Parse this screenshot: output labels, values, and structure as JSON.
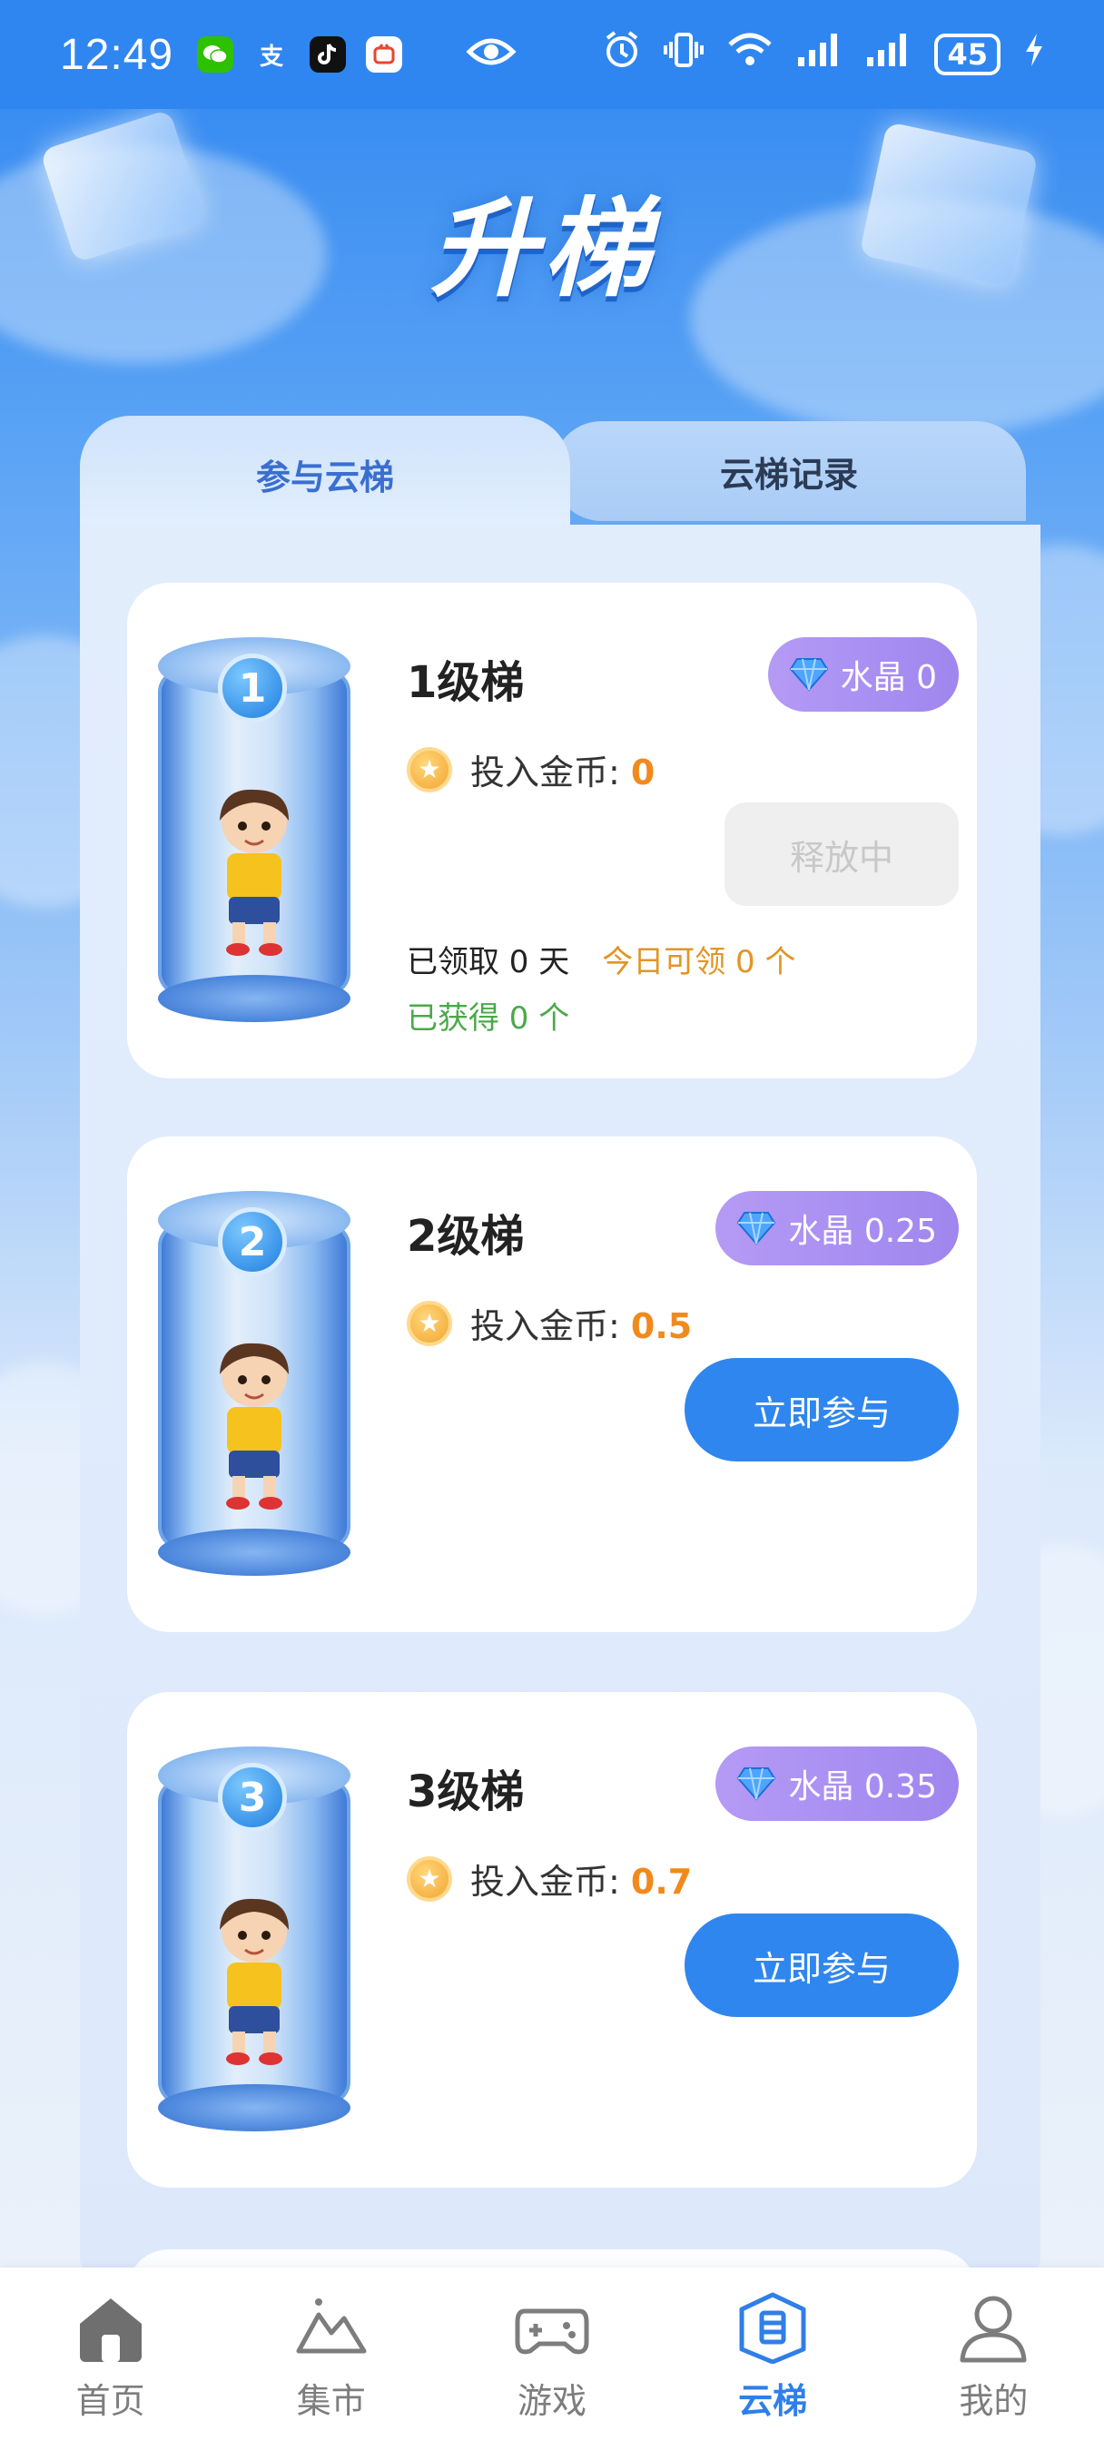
{
  "status_bar": {
    "time": "12:49",
    "apps": [
      "wechat-icon",
      "alipay-icon",
      "tiktok-icon",
      "app-icon"
    ],
    "alipay_glyph": "支",
    "battery": "45"
  },
  "page": {
    "title": "升梯"
  },
  "tabs": [
    {
      "label": "参与云梯",
      "active": true
    },
    {
      "label": "云梯记录",
      "active": false
    }
  ],
  "cards": [
    {
      "level_num": "1",
      "title": "1级梯",
      "crystal_label": "水晶 0",
      "coin_label": "投入金币: ",
      "coin_value": "0",
      "button_label": "释放中",
      "claimed": "已领取 0 天",
      "today": "今日可领 0 个",
      "got": "已获得 0 个"
    },
    {
      "level_num": "2",
      "title": "2级梯",
      "crystal_label": "水晶 0.25",
      "coin_label": "投入金币: ",
      "coin_value": "0.5",
      "button_label": "立即参与"
    },
    {
      "level_num": "3",
      "title": "3级梯",
      "crystal_label": "水晶 0.35",
      "coin_label": "投入金币: ",
      "coin_value": "0.7",
      "button_label": "立即参与"
    }
  ],
  "bottom_nav": [
    {
      "label": "首页",
      "icon": "home-icon"
    },
    {
      "label": "集市",
      "icon": "mountain-icon"
    },
    {
      "label": "游戏",
      "icon": "gamepad-icon"
    },
    {
      "label": "云梯",
      "icon": "ladder-icon",
      "active": true
    },
    {
      "label": "我的",
      "icon": "user-icon"
    }
  ],
  "colors": {
    "accent": "#2f86ee",
    "crystal_badge": "#a98ff0",
    "coin_value": "#f08a1c",
    "today_text": "#e49423",
    "got_text": "#4aa94a"
  }
}
